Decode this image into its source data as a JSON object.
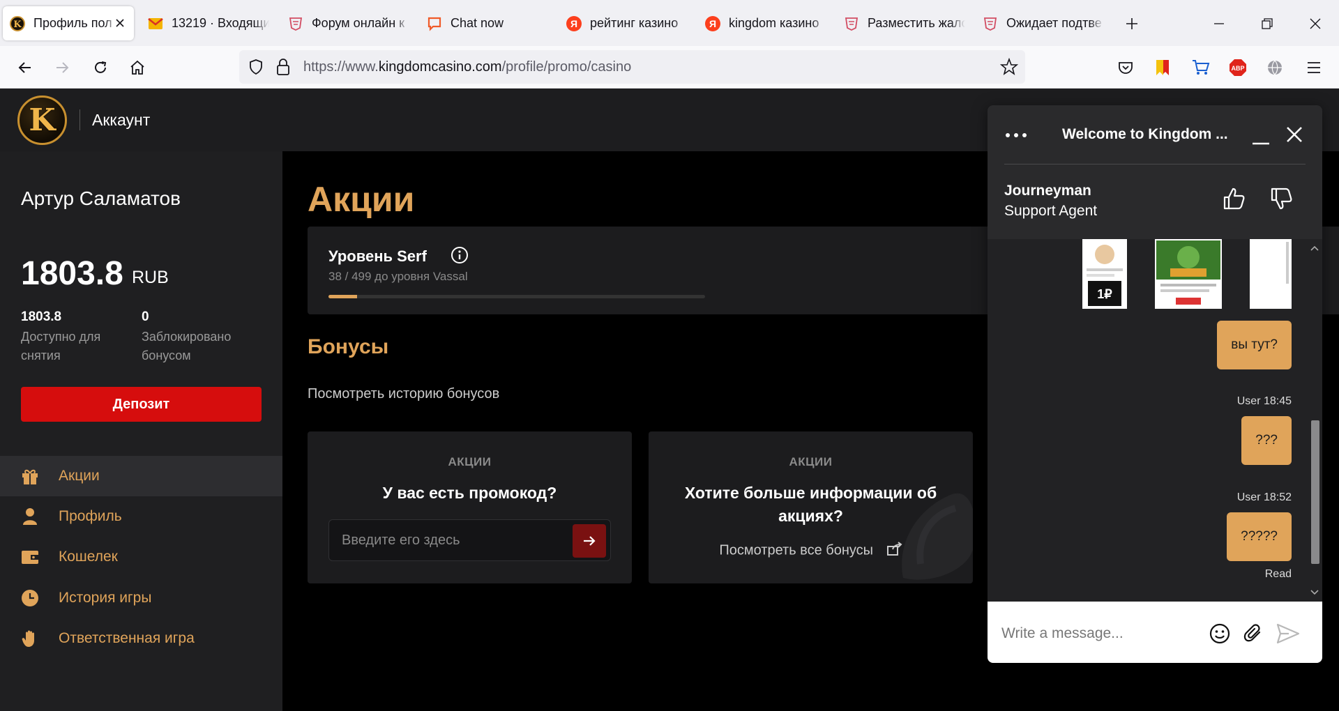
{
  "browser": {
    "tabs": [
      {
        "title": "Профиль пол",
        "active": true
      },
      {
        "title": "13219 · Входящи"
      },
      {
        "title": "Форум онлайн к"
      },
      {
        "title": "Chat now"
      },
      {
        "title": "рейтинг казино"
      },
      {
        "title": "kingdom казино"
      },
      {
        "title": "Разместить жало"
      },
      {
        "title": "Ожидает подтве"
      }
    ],
    "url_prefix": "https://www.",
    "url_host": "kingdomcasino.com",
    "url_path": "/profile/promo/casino"
  },
  "header": {
    "logo_letter": "K",
    "title": "Аккаунт"
  },
  "sidebar": {
    "user_name": "Артур Саламатов",
    "balance": "1803.8",
    "currency": "RUB",
    "available_value": "1803.8",
    "available_label": "Доступно для снятия",
    "blocked_value": "0",
    "blocked_label": "Заблокировано бонусом",
    "deposit_label": "Депозит",
    "items": [
      {
        "label": "Акции",
        "icon": "gift-icon",
        "active": true
      },
      {
        "label": "Профиль",
        "icon": "user-icon"
      },
      {
        "label": "Кошелек",
        "icon": "wallet-icon"
      },
      {
        "label": "История игры",
        "icon": "clock-icon"
      },
      {
        "label": "Ответственная игра",
        "icon": "hand-icon"
      }
    ]
  },
  "main": {
    "title": "Акции",
    "level": {
      "title": "Уровень Serf",
      "subtitle": "38 / 499 до уровня Vassal",
      "progress": 0.076
    },
    "bonuses_title": "Бонусы",
    "bonus_history": "Посмотреть историю бонусов",
    "promo_card": {
      "category": "АКЦИИ",
      "heading": "У вас есть промокод?",
      "placeholder": "Введите его здесь"
    },
    "info_card": {
      "category": "АКЦИИ",
      "heading": "Хотите больше информации об акциях?",
      "link": "Посмотреть все бонусы"
    }
  },
  "chat": {
    "title": "Welcome to Kingdom ...",
    "agent_name": "Journeyman",
    "agent_role": "Support Agent",
    "messages": [
      {
        "text": "вы тут?"
      },
      {
        "meta": "User 18:45",
        "text": "???"
      },
      {
        "meta": "User 18:52",
        "text": "?????",
        "status": "Read"
      }
    ],
    "input_placeholder": "Write a message..."
  },
  "colors": {
    "accent": "#e0a45a",
    "deposit": "#d60d0d",
    "panel": "#1f1f21"
  }
}
